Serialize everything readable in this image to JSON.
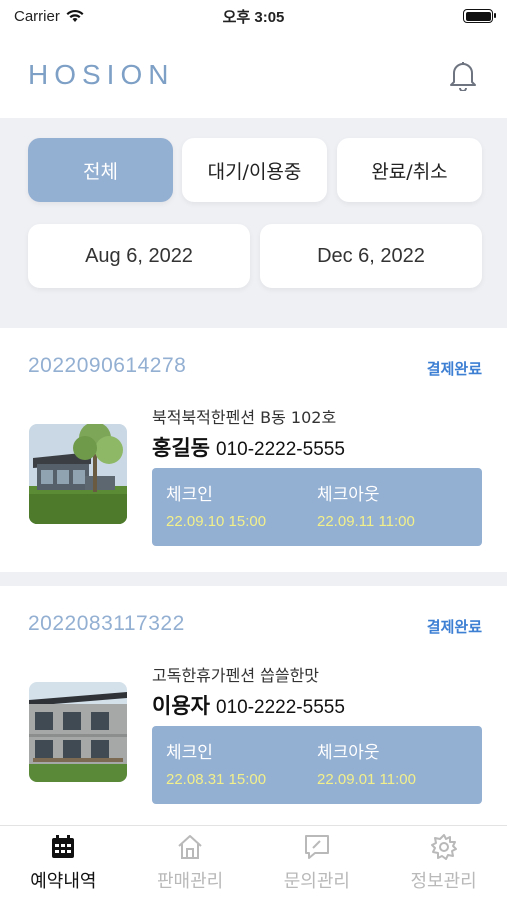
{
  "status_bar": {
    "carrier": "Carrier",
    "time": "오후 3:05"
  },
  "header": {
    "logo": "HOSION",
    "bell_icon": "bell-icon"
  },
  "filters": {
    "segments": [
      "전체",
      "대기/이용중",
      "완료/취소"
    ],
    "active_index": 0,
    "start_date": "Aug 6, 2022",
    "end_date": "Dec 6, 2022"
  },
  "reservations": [
    {
      "number": "2022090614278",
      "status": "결제완료",
      "pension": "북적북적한펜션 B동 102호",
      "guest_name": "홍길동",
      "phone": "010-2222-5555",
      "checkin_label": "체크인",
      "checkin": "22.09.10 15:00",
      "checkout_label": "체크아웃",
      "checkout": "22.09.11 11:00"
    },
    {
      "number": "2022083117322",
      "status": "결제완료",
      "pension": "고독한휴가펜션 씁쓸한맛",
      "guest_name": "이용자",
      "phone": "010-2222-5555",
      "checkin_label": "체크인",
      "checkin": "22.08.31 15:00",
      "checkout_label": "체크아웃",
      "checkout": "22.09.01 11:00"
    }
  ],
  "tabbar": {
    "items": [
      {
        "label": "예약내역",
        "icon": "calendar-icon",
        "active": true
      },
      {
        "label": "판매관리",
        "icon": "home-icon",
        "active": false
      },
      {
        "label": "문의관리",
        "icon": "chat-icon",
        "active": false
      },
      {
        "label": "정보관리",
        "icon": "gear-icon",
        "active": false
      }
    ]
  },
  "colors": {
    "accent": "#93afd2",
    "logo": "#7ea0c6",
    "status": "#3d7fd3",
    "date_value": "#f3f08a"
  }
}
